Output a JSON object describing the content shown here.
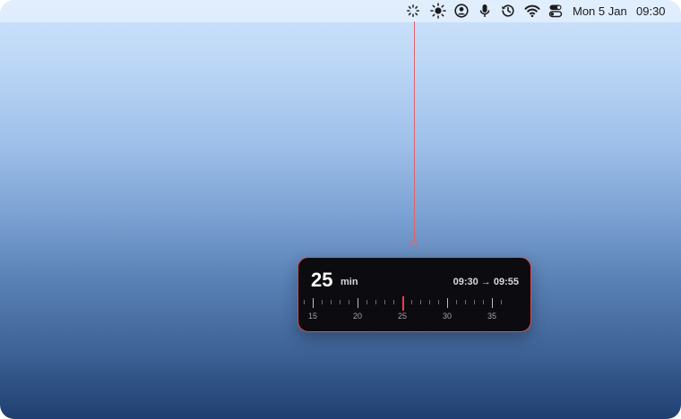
{
  "menubar": {
    "icons": [
      "loader-icon",
      "brightness-icon",
      "user-account-icon",
      "microphone-icon",
      "time-machine-icon",
      "wifi-icon",
      "control-center-icon"
    ],
    "date": "Mon 5 Jan",
    "time": "09:30"
  },
  "timer": {
    "duration_value": "25",
    "duration_unit": "min",
    "time_range": "09:30 → 09:55",
    "scale": {
      "min": 15,
      "max": 35,
      "current": 25,
      "labels": [
        "15",
        "20",
        "25",
        "30",
        "35"
      ]
    }
  },
  "colors": {
    "accent": "#e0636b",
    "current_marker": "#e8414c",
    "panel_background": "#0c0c10"
  }
}
